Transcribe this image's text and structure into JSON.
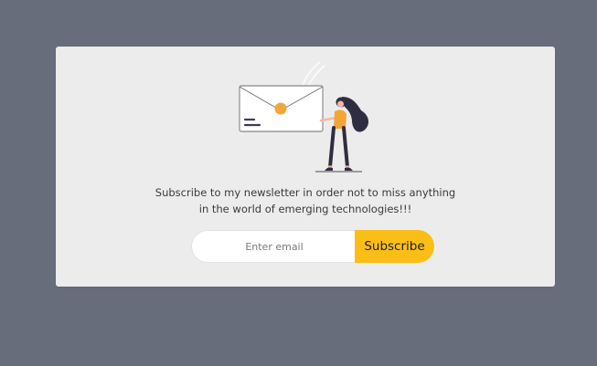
{
  "newsletter": {
    "message_line1": "Subscribe to my newsletter in order not to miss anything",
    "message_line2": "in the world of emerging technologies!!!",
    "email_placeholder": "Enter email",
    "subscribe_label": "Subscribe"
  },
  "colors": {
    "page_background": "#676d7a",
    "card_background": "#ececec",
    "accent": "#fbbe16",
    "illustration_orange": "#f3a536",
    "illustration_dark": "#2f2e41"
  },
  "icons": {
    "illustration": "envelope-with-woman-illustration"
  }
}
